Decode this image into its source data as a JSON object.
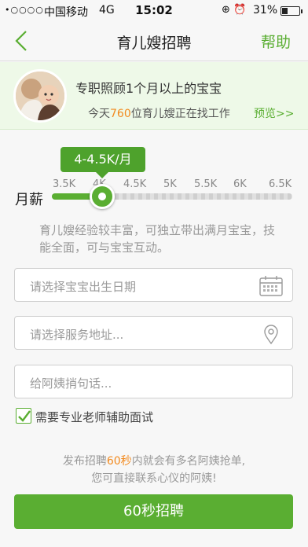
{
  "status_bar": {
    "signal": "•○○○○",
    "carrier": "中国移动",
    "network": "4G",
    "time": "15:02",
    "right_icons": "⊕ ⏰",
    "battery": "31%"
  },
  "nav": {
    "title": "育儿嫂招聘",
    "help": "帮助"
  },
  "banner": {
    "headline": "专职照顾1个月以上的宝宝",
    "sub_prefix": "今天",
    "sub_number": "760",
    "sub_suffix": "位育儿嫂正在找工作",
    "preview": "预览>>"
  },
  "salary": {
    "label": "月薪",
    "selected": "4-4.5K/月",
    "ticks": [
      "3.5K",
      "4K",
      "4.5K",
      "5K",
      "5.5K",
      "6K",
      "6.5K"
    ],
    "level": "4K",
    "description": "育儿嫂经验较丰富，可独立带出满月宝宝，技能全面，可与宝宝互动。"
  },
  "form": {
    "birth_placeholder": "请选择宝宝出生日期",
    "address_placeholder": "请选择服务地址...",
    "message_placeholder": "给阿姨捎句话..."
  },
  "assist": {
    "label": "需要专业老师辅助面试",
    "checked": true
  },
  "note": {
    "prefix": "发布招聘",
    "highlight": "60秒",
    "suffix": "内就会有多名阿姨抢单,",
    "line2": "您可直接联系心仪的阿姨!"
  },
  "cta": {
    "label": "60秒招聘"
  },
  "colors": {
    "accent": "#5aae32",
    "highlight": "#f28a1f",
    "banner_bg": "#eef9e8"
  }
}
